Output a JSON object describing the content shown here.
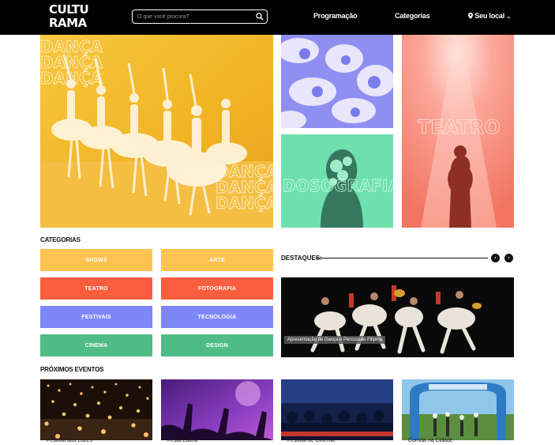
{
  "header": {
    "logo_lines": [
      "CULTU",
      "RAMA"
    ],
    "search_placeholder": "O que você procura?",
    "nav": [
      "Programação",
      "Categorias"
    ],
    "location": "Seu local"
  },
  "hero": {
    "main_words": [
      "DANÇA",
      "DANÇA",
      "DANÇA",
      "DANÇA",
      "DANÇA",
      "DANÇA"
    ],
    "tile_words": [
      "DOSOGRAFIA",
      "TEATRO"
    ]
  },
  "categories": {
    "title": "CATEGORIAS",
    "items": [
      {
        "label": "SHOWS",
        "color": "#FDC351"
      },
      {
        "label": "ARTE",
        "color": "#FDC351"
      },
      {
        "label": "TEATRO",
        "color": "#FB5E3E"
      },
      {
        "label": "FOTOGRAFIA",
        "color": "#FB5E3E"
      },
      {
        "label": "FESTIVAIS",
        "color": "#7E87F8"
      },
      {
        "label": "TECNOLOGIA",
        "color": "#7E87F8"
      },
      {
        "label": "CINEMA",
        "color": "#4FBB85"
      },
      {
        "label": "DESIGN",
        "color": "#4FBB85"
      }
    ]
  },
  "highlights": {
    "title": "DESTAQUES:",
    "caption": "Apresentação de Dança e Percussão Filipina"
  },
  "upcoming": {
    "title": "PRÓXIMOS EVENTOS",
    "events": [
      "Festival das Luzes",
      "Festa Latina",
      "Festival de Cinema",
      "Corrida na Cidade"
    ]
  }
}
